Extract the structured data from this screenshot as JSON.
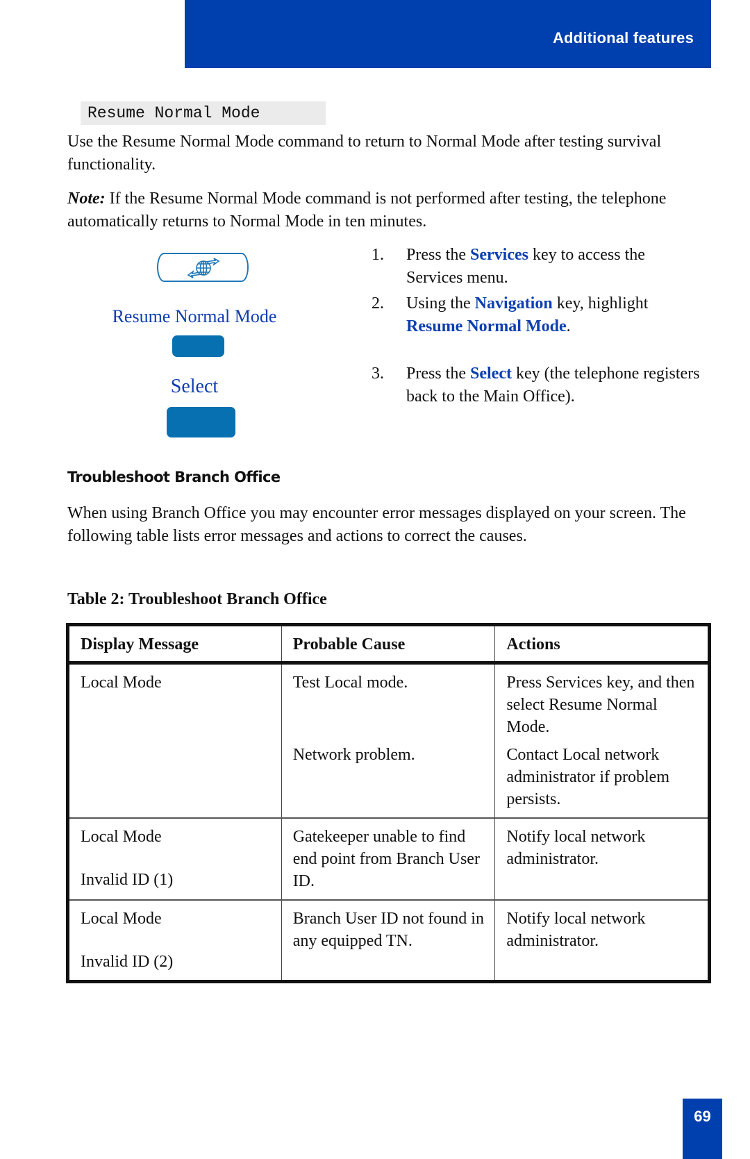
{
  "header": {
    "title": "Additional features"
  },
  "command": {
    "label": "Resume Normal Mode"
  },
  "intro": {
    "text": "Use the Resume Normal Mode command to return to Normal Mode after testing survival functionality."
  },
  "note": {
    "label": "Note:",
    "text": " If the Resume Normal Mode command is not performed after testing, the telephone automatically returns to Normal Mode in ten minutes."
  },
  "phone_graphic": {
    "services_key_icon": "globe-arrows-icon",
    "softkey1_label": "Resume Normal Mode",
    "softkey2_label": "Select",
    "accent_color": "#0770b0"
  },
  "steps": [
    {
      "num": "1.",
      "pre": "Press the ",
      "kw": "Services",
      "post": " key to access the Services menu."
    },
    {
      "num": "2.",
      "pre": "Using the ",
      "kw": "Navigation",
      "mid": " key, highlight ",
      "kw2": "Resume Normal Mode",
      "post": "."
    },
    {
      "num": "3.",
      "pre": "Press the ",
      "kw": "Select",
      "post": " key (the telephone registers back to the Main Office)."
    }
  ],
  "section": {
    "heading": "Troubleshoot Branch Office",
    "text": "When using Branch Office you may encounter error messages displayed on your screen. The following table lists error messages and actions to correct the causes."
  },
  "table": {
    "caption": "Table 2: Troubleshoot Branch Office",
    "headers": [
      "Display Message",
      "Probable Cause",
      "Actions"
    ],
    "rows": [
      {
        "display": [
          "Local Mode"
        ],
        "causes": [
          "Test Local mode.",
          "Network problem."
        ],
        "actions": [
          "Press Services key, and then select Resume Normal Mode.",
          "Contact Local network administrator if problem persists."
        ]
      },
      {
        "display": [
          "Local Mode",
          "Invalid ID (1)"
        ],
        "causes": [
          "Gatekeeper unable to find end point from Branch User ID."
        ],
        "actions": [
          "Notify local network administrator."
        ]
      },
      {
        "display": [
          "Local Mode",
          "Invalid ID (2)"
        ],
        "causes": [
          "Branch User ID not found in any equipped TN."
        ],
        "actions": [
          "Notify local network administrator."
        ]
      }
    ]
  },
  "footer": {
    "page_number": "69"
  },
  "colors": {
    "brand_blue": "#003fae",
    "link_blue": "#0d3fb0",
    "softkey_blue": "#0770b0"
  }
}
